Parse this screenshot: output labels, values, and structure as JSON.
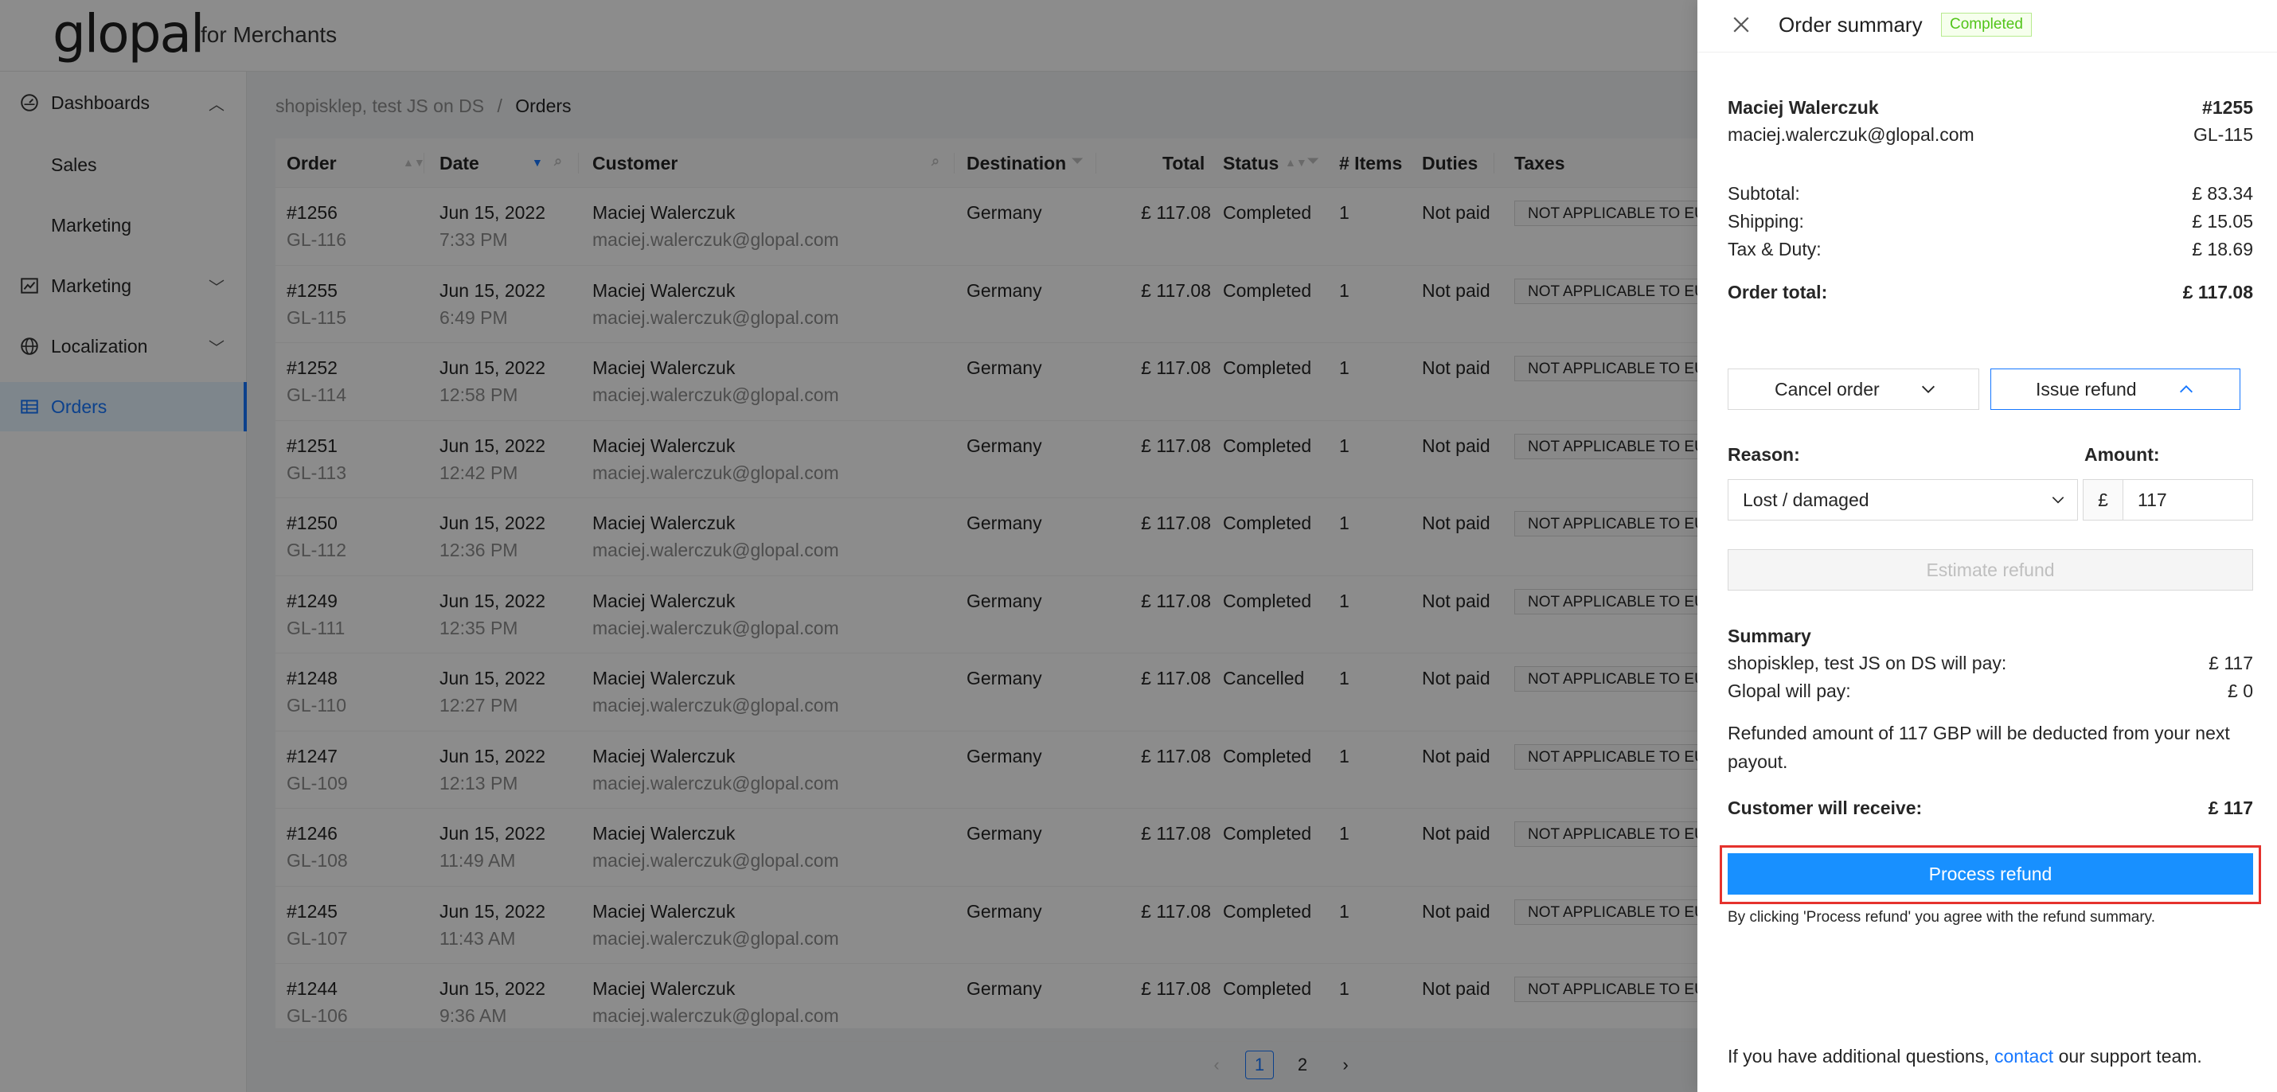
{
  "header": {
    "logo": "glopal",
    "logo_sub": "for Merchants"
  },
  "sidebar": {
    "items": [
      {
        "label": "Dashboards",
        "icon": "dashboard-icon",
        "chev": "^"
      },
      {
        "label": "Sales"
      },
      {
        "label": "Marketing"
      },
      {
        "label": "Marketing",
        "icon": "chart-icon",
        "chev": "v"
      },
      {
        "label": "Localization",
        "icon": "globe-icon",
        "chev": "v"
      },
      {
        "label": "Orders",
        "icon": "table-icon"
      }
    ]
  },
  "breadcrumb": {
    "parent": "shopisklep, test JS on DS",
    "sep": "/",
    "current": "Orders"
  },
  "table": {
    "headers": [
      "Order",
      "Date",
      "Customer",
      "Destination",
      "Total",
      "Status",
      "# Items",
      "Duties",
      "Taxes"
    ],
    "rows": [
      {
        "order": "#1256",
        "gl": "GL-116",
        "date": "Jun 15, 2022",
        "time": "7:33 PM",
        "name": "Maciej Walerczuk",
        "email": "maciej.walerczuk@glopal.com",
        "dest": "Germany",
        "total": "£ 117.08",
        "status": "Completed",
        "items": "1",
        "duties": "Not paid",
        "taxes": "NOT APPLICABLE TO EU"
      },
      {
        "order": "#1255",
        "gl": "GL-115",
        "date": "Jun 15, 2022",
        "time": "6:49 PM",
        "name": "Maciej Walerczuk",
        "email": "maciej.walerczuk@glopal.com",
        "dest": "Germany",
        "total": "£ 117.08",
        "status": "Completed",
        "items": "1",
        "duties": "Not paid",
        "taxes": "NOT APPLICABLE TO EU"
      },
      {
        "order": "#1252",
        "gl": "GL-114",
        "date": "Jun 15, 2022",
        "time": "12:58 PM",
        "name": "Maciej Walerczuk",
        "email": "maciej.walerczuk@glopal.com",
        "dest": "Germany",
        "total": "£ 117.08",
        "status": "Completed",
        "items": "1",
        "duties": "Not paid",
        "taxes": "NOT APPLICABLE TO EU"
      },
      {
        "order": "#1251",
        "gl": "GL-113",
        "date": "Jun 15, 2022",
        "time": "12:42 PM",
        "name": "Maciej Walerczuk",
        "email": "maciej.walerczuk@glopal.com",
        "dest": "Germany",
        "total": "£ 117.08",
        "status": "Completed",
        "items": "1",
        "duties": "Not paid",
        "taxes": "NOT APPLICABLE TO EU"
      },
      {
        "order": "#1250",
        "gl": "GL-112",
        "date": "Jun 15, 2022",
        "time": "12:36 PM",
        "name": "Maciej Walerczuk",
        "email": "maciej.walerczuk@glopal.com",
        "dest": "Germany",
        "total": "£ 117.08",
        "status": "Completed",
        "items": "1",
        "duties": "Not paid",
        "taxes": "NOT APPLICABLE TO EU"
      },
      {
        "order": "#1249",
        "gl": "GL-111",
        "date": "Jun 15, 2022",
        "time": "12:35 PM",
        "name": "Maciej Walerczuk",
        "email": "maciej.walerczuk@glopal.com",
        "dest": "Germany",
        "total": "£ 117.08",
        "status": "Completed",
        "items": "1",
        "duties": "Not paid",
        "taxes": "NOT APPLICABLE TO EU"
      },
      {
        "order": "#1248",
        "gl": "GL-110",
        "date": "Jun 15, 2022",
        "time": "12:27 PM",
        "name": "Maciej Walerczuk",
        "email": "maciej.walerczuk@glopal.com",
        "dest": "Germany",
        "total": "£ 117.08",
        "status": "Cancelled",
        "items": "1",
        "duties": "Not paid",
        "taxes": "NOT APPLICABLE TO EU"
      },
      {
        "order": "#1247",
        "gl": "GL-109",
        "date": "Jun 15, 2022",
        "time": "12:13 PM",
        "name": "Maciej Walerczuk",
        "email": "maciej.walerczuk@glopal.com",
        "dest": "Germany",
        "total": "£ 117.08",
        "status": "Completed",
        "items": "1",
        "duties": "Not paid",
        "taxes": "NOT APPLICABLE TO EU"
      },
      {
        "order": "#1246",
        "gl": "GL-108",
        "date": "Jun 15, 2022",
        "time": "11:49 AM",
        "name": "Maciej Walerczuk",
        "email": "maciej.walerczuk@glopal.com",
        "dest": "Germany",
        "total": "£ 117.08",
        "status": "Completed",
        "items": "1",
        "duties": "Not paid",
        "taxes": "NOT APPLICABLE TO EU"
      },
      {
        "order": "#1245",
        "gl": "GL-107",
        "date": "Jun 15, 2022",
        "time": "11:43 AM",
        "name": "Maciej Walerczuk",
        "email": "maciej.walerczuk@glopal.com",
        "dest": "Germany",
        "total": "£ 117.08",
        "status": "Completed",
        "items": "1",
        "duties": "Not paid",
        "taxes": "NOT APPLICABLE TO EU"
      },
      {
        "order": "#1244",
        "gl": "GL-106",
        "date": "Jun 15, 2022",
        "time": "9:36 AM",
        "name": "Maciej Walerczuk",
        "email": "maciej.walerczuk@glopal.com",
        "dest": "Germany",
        "total": "£ 117.08",
        "status": "Completed",
        "items": "1",
        "duties": "Not paid",
        "taxes": "NOT APPLICABLE TO EU"
      }
    ]
  },
  "pagination": {
    "prev": "‹",
    "pages": [
      "1",
      "2"
    ],
    "next": "›"
  },
  "drawer": {
    "title": "Order summary",
    "status_badge": "Completed",
    "customer_name": "Maciej Walerczuk",
    "order_no": "#1255",
    "customer_email": "maciej.walerczuk@glopal.com",
    "gl_no": "GL-115",
    "subtotal_label": "Subtotal:",
    "subtotal": "£ 83.34",
    "shipping_label": "Shipping:",
    "shipping": "£ 15.05",
    "tax_label": "Tax & Duty:",
    "tax": "£ 18.69",
    "total_label": "Order total:",
    "total": "£ 117.08",
    "cancel_label": "Cancel order",
    "refund_label": "Issue refund",
    "reason_label": "Reason:",
    "reason_value": "Lost / damaged",
    "amount_label": "Amount:",
    "currency": "£",
    "amount_value": "117",
    "estimate_label": "Estimate refund",
    "summary_label": "Summary",
    "merchant_pay_label": "shopisklep, test JS on DS will pay:",
    "merchant_pay": "£ 117",
    "glopal_pay_label": "Glopal will pay:",
    "glopal_pay": "£ 0",
    "deduct_note_1": "Refunded amount of 117 GBP will be deducted from your next",
    "deduct_note_2": "payout.",
    "receive_label": "Customer will receive:",
    "receive": "£ 117",
    "process_label": "Process refund",
    "agree_note": "By clicking 'Process refund' you agree with the refund summary.",
    "footer_pre": "If you have additional questions,",
    "footer_link": "contact",
    "footer_post": "our support team."
  },
  "colors": {
    "accent": "#1677ff",
    "primary_button": "#1890ff",
    "highlight": "#e5322d",
    "success": "#52c41a"
  }
}
